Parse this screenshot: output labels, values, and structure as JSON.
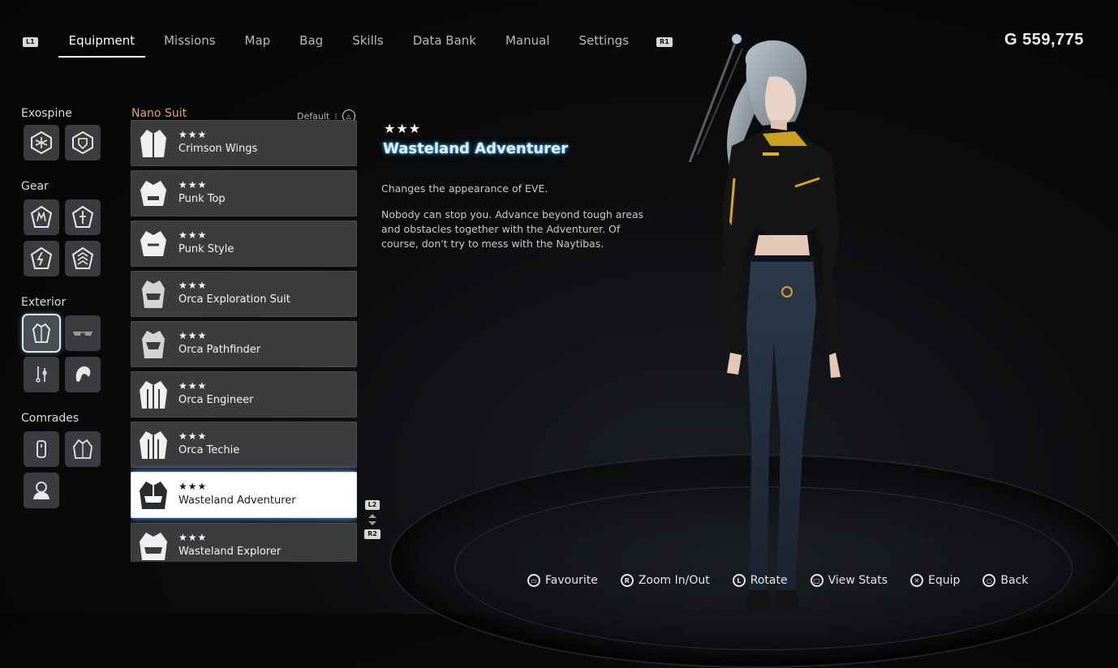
{
  "nav": {
    "left_trigger": "L1",
    "right_trigger": "R1",
    "tabs": [
      {
        "label": "Equipment",
        "active": true
      },
      {
        "label": "Missions",
        "active": false
      },
      {
        "label": "Map",
        "active": false
      },
      {
        "label": "Bag",
        "active": false
      },
      {
        "label": "Skills",
        "active": false
      },
      {
        "label": "Data Bank",
        "active": false
      },
      {
        "label": "Manual",
        "active": false
      },
      {
        "label": "Settings",
        "active": false
      }
    ]
  },
  "currency": {
    "symbol": "G",
    "amount": "559,775"
  },
  "categories": {
    "exospine": "Exospine",
    "gear": "Gear",
    "exterior": "Exterior",
    "comrades": "Comrades"
  },
  "list": {
    "title": "Nano Suit",
    "sort_label": "Default",
    "sort_button_icon": "triangle-button-icon",
    "items": [
      {
        "stars": "★★★",
        "name": "Crimson Wings",
        "selected": false
      },
      {
        "stars": "★★★",
        "name": "Punk Top",
        "selected": false
      },
      {
        "stars": "★★★",
        "name": "Punk Style",
        "selected": false
      },
      {
        "stars": "★★★",
        "name": "Orca Exploration Suit",
        "selected": false
      },
      {
        "stars": "★★★",
        "name": "Orca Pathfinder",
        "selected": false
      },
      {
        "stars": "★★★",
        "name": "Orca Engineer",
        "selected": false
      },
      {
        "stars": "★★★",
        "name": "Orca Techie",
        "selected": false
      },
      {
        "stars": "★★★",
        "name": "Wasteland Adventurer",
        "selected": true
      },
      {
        "stars": "★★★",
        "name": "Wasteland Explorer",
        "selected": false
      }
    ],
    "scroll_up_tag": "L2",
    "scroll_down_tag": "R2"
  },
  "detail": {
    "stars": "★★★",
    "title": "Wasteland Adventurer",
    "summary": "Changes the appearance of EVE.",
    "description": "Nobody can stop you. Advance beyond tough areas and obstacles together with the Adventurer. Of course, don't try to mess with the Naytibas."
  },
  "actions": [
    {
      "icon": "ps-touchpad-button-icon",
      "glyph": "▭",
      "label": "Favourite"
    },
    {
      "icon": "right-stick-icon",
      "glyph": "R",
      "label": "Zoom In/Out"
    },
    {
      "icon": "left-stick-icon",
      "glyph": "L",
      "label": "Rotate"
    },
    {
      "icon": "square-button-icon",
      "glyph": "□",
      "label": "View Stats"
    },
    {
      "icon": "cross-button-icon",
      "glyph": "✕",
      "label": "Equip"
    },
    {
      "icon": "circle-button-icon",
      "glyph": "○",
      "label": "Back"
    }
  ],
  "colors": {
    "accent_orange": "#e7a25e",
    "selected_glow": "#6fa9ff",
    "title_glow": "#3aa0ff"
  }
}
